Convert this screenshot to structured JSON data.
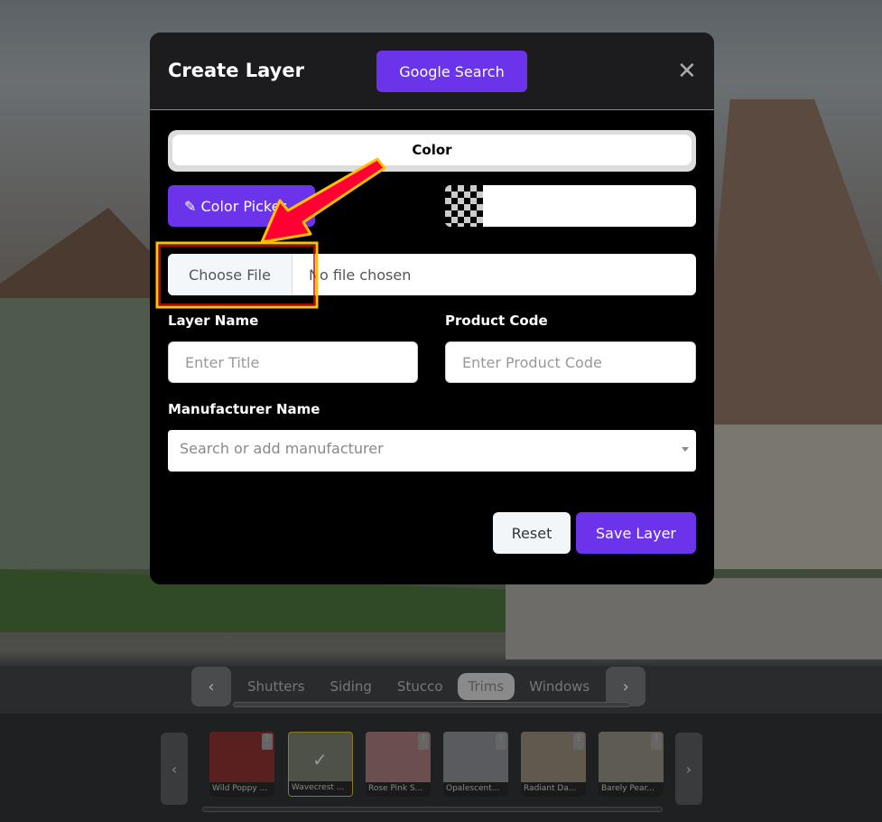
{
  "modal": {
    "title": "Create Layer",
    "google_search": "Google Search",
    "close_icon": "close-icon",
    "tab": "Color",
    "color_picker": "Color Picker",
    "choose_file": "Choose File",
    "no_file": "No file chosen",
    "layer_name_label": "Layer Name",
    "layer_name_placeholder": "Enter Title",
    "product_code_label": "Product Code",
    "product_code_placeholder": "Enter Product Code",
    "manufacturer_label": "Manufacturer Name",
    "manufacturer_placeholder": "Search or add manufacturer",
    "reset": "Reset",
    "save": "Save Layer"
  },
  "categories": [
    "Shutters",
    "Siding",
    "Stucco",
    "Trims",
    "Windows"
  ],
  "active_category": "Trims",
  "swatches": [
    {
      "name": "Wild Poppy ...",
      "color": "#5a2020"
    },
    {
      "name": "Wavecrest ...",
      "color": "#4e5148",
      "selected": true
    },
    {
      "name": "Rose Pink S...",
      "color": "#6a4e50"
    },
    {
      "name": "Opalescent...",
      "color": "#5a5b5e"
    },
    {
      "name": "Radiant Da...",
      "color": "#5f594e"
    },
    {
      "name": "Barely Pear...",
      "color": "#5e5c52"
    }
  ],
  "colors": {
    "accent": "#6b33ea",
    "annotation_arrow": "#ff0033",
    "annotation_outline": "#ffc000"
  }
}
